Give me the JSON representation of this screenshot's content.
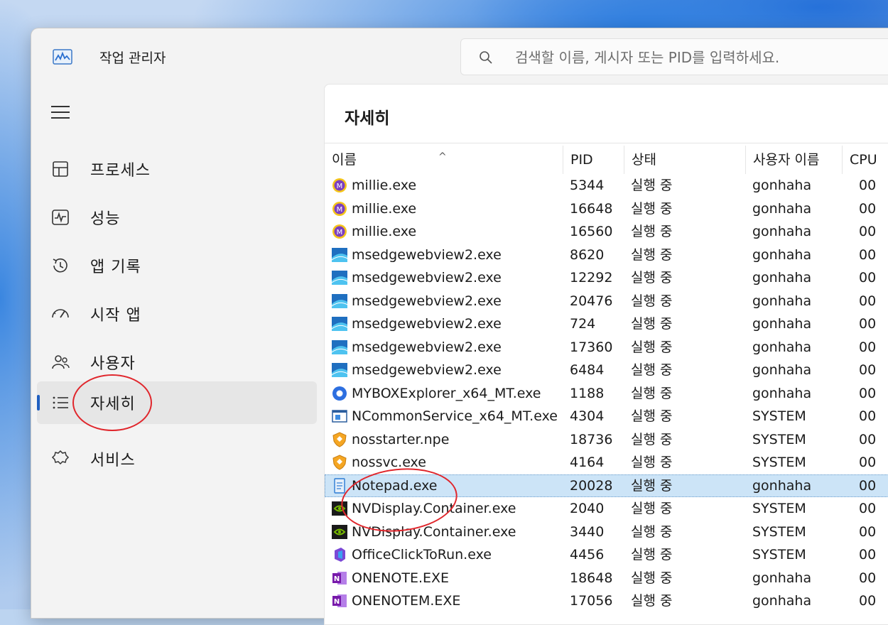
{
  "app": {
    "title": "작업 관리자"
  },
  "search": {
    "placeholder": "검색할 이름, 게시자 또는 PID를 입력하세요."
  },
  "nav": [
    {
      "label": "프로세스",
      "icon": "processes-icon",
      "active": false
    },
    {
      "label": "성능",
      "icon": "performance-icon",
      "active": false
    },
    {
      "label": "앱 기록",
      "icon": "app-history-icon",
      "active": false
    },
    {
      "label": "시작 앱",
      "icon": "startup-apps-icon",
      "active": false
    },
    {
      "label": "사용자",
      "icon": "users-icon",
      "active": false
    },
    {
      "label": "자세히",
      "icon": "details-icon",
      "active": true
    },
    {
      "label": "서비스",
      "icon": "services-icon",
      "active": false
    }
  ],
  "panel": {
    "title": "자세히"
  },
  "columns": [
    "이름",
    "PID",
    "상태",
    "사용자 이름",
    "CPU"
  ],
  "rows": [
    {
      "name": "millie.exe",
      "pid": "5344",
      "status": "실행 중",
      "user": "gonhaha",
      "cpu": "00",
      "icon": "millie-app-icon"
    },
    {
      "name": "millie.exe",
      "pid": "16648",
      "status": "실행 중",
      "user": "gonhaha",
      "cpu": "00",
      "icon": "millie-app-icon"
    },
    {
      "name": "millie.exe",
      "pid": "16560",
      "status": "실행 중",
      "user": "gonhaha",
      "cpu": "00",
      "icon": "millie-app-icon"
    },
    {
      "name": "msedgewebview2.exe",
      "pid": "8620",
      "status": "실행 중",
      "user": "gonhaha",
      "cpu": "00",
      "icon": "webview-icon"
    },
    {
      "name": "msedgewebview2.exe",
      "pid": "12292",
      "status": "실행 중",
      "user": "gonhaha",
      "cpu": "00",
      "icon": "webview-icon"
    },
    {
      "name": "msedgewebview2.exe",
      "pid": "20476",
      "status": "실행 중",
      "user": "gonhaha",
      "cpu": "00",
      "icon": "webview-icon"
    },
    {
      "name": "msedgewebview2.exe",
      "pid": "724",
      "status": "실행 중",
      "user": "gonhaha",
      "cpu": "00",
      "icon": "webview-icon"
    },
    {
      "name": "msedgewebview2.exe",
      "pid": "17360",
      "status": "실행 중",
      "user": "gonhaha",
      "cpu": "00",
      "icon": "webview-icon"
    },
    {
      "name": "msedgewebview2.exe",
      "pid": "6484",
      "status": "실행 중",
      "user": "gonhaha",
      "cpu": "00",
      "icon": "webview-icon"
    },
    {
      "name": "MYBOXExplorer_x64_MT.exe",
      "pid": "1188",
      "status": "실행 중",
      "user": "gonhaha",
      "cpu": "00",
      "icon": "mybox-icon"
    },
    {
      "name": "NCommonService_x64_MT.exe",
      "pid": "4304",
      "status": "실행 중",
      "user": "SYSTEM",
      "cpu": "00",
      "icon": "service-window-icon"
    },
    {
      "name": "nosstarter.npe",
      "pid": "18736",
      "status": "실행 중",
      "user": "SYSTEM",
      "cpu": "00",
      "icon": "shield-icon"
    },
    {
      "name": "nossvc.exe",
      "pid": "4164",
      "status": "실행 중",
      "user": "SYSTEM",
      "cpu": "00",
      "icon": "shield-icon"
    },
    {
      "name": "Notepad.exe",
      "pid": "20028",
      "status": "실행 중",
      "user": "gonhaha",
      "cpu": "00",
      "icon": "notepad-icon",
      "selected": true
    },
    {
      "name": "NVDisplay.Container.exe",
      "pid": "2040",
      "status": "실행 중",
      "user": "SYSTEM",
      "cpu": "00",
      "icon": "nvidia-icon"
    },
    {
      "name": "NVDisplay.Container.exe",
      "pid": "3440",
      "status": "실행 중",
      "user": "SYSTEM",
      "cpu": "00",
      "icon": "nvidia-icon"
    },
    {
      "name": "OfficeClickToRun.exe",
      "pid": "4456",
      "status": "실행 중",
      "user": "SYSTEM",
      "cpu": "00",
      "icon": "office-icon"
    },
    {
      "name": "ONENOTE.EXE",
      "pid": "18648",
      "status": "실행 중",
      "user": "gonhaha",
      "cpu": "00",
      "icon": "onenote-icon"
    },
    {
      "name": "ONENOTEM.EXE",
      "pid": "17056",
      "status": "실행 중",
      "user": "gonhaha",
      "cpu": "00",
      "icon": "onenote-icon"
    }
  ],
  "colors": {
    "accent": "#1f5fc0",
    "selection": "#cce4f7",
    "annotation": "#e0262c"
  }
}
